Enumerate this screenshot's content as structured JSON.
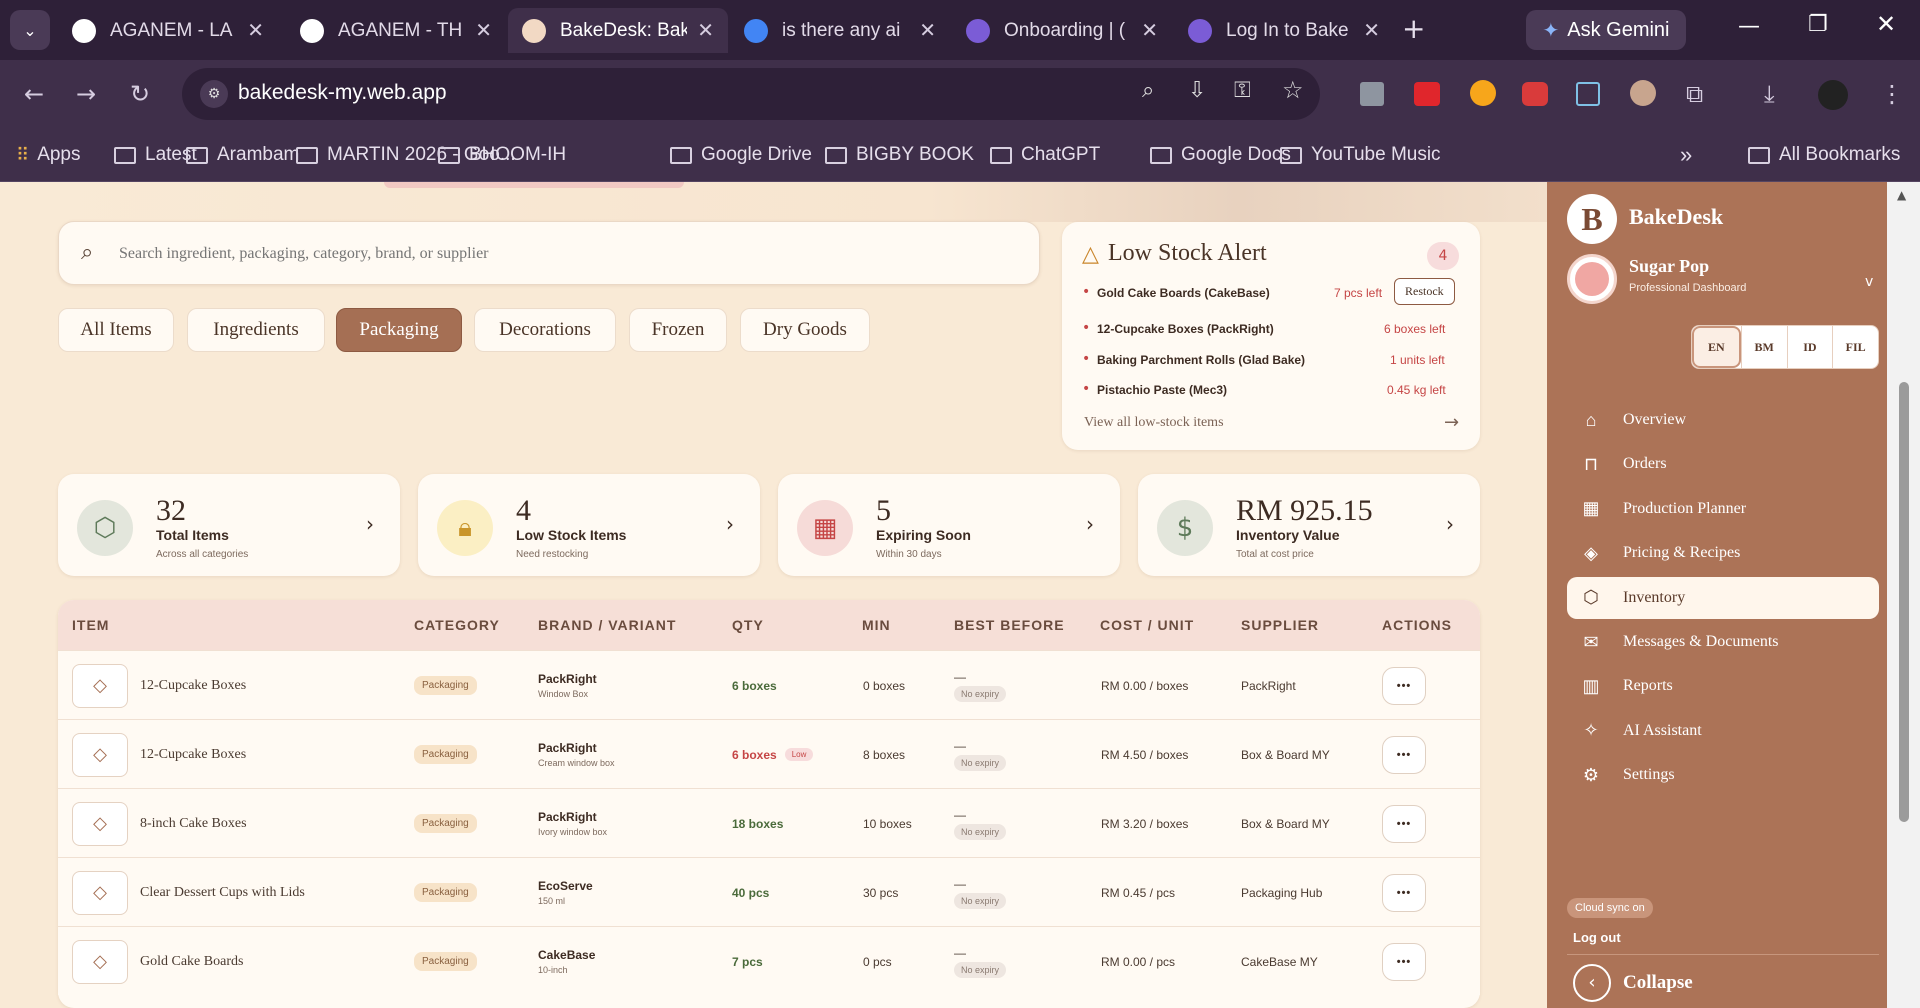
{
  "browser": {
    "tabs": [
      {
        "title": "AGANEM - LA",
        "color": "#ffffff"
      },
      {
        "title": "AGANEM - TH",
        "color": "#ffffff"
      },
      {
        "title": "BakeDesk: Bak",
        "color": "#f2d9c4"
      },
      {
        "title": "is there any ai",
        "color": "#4285f4"
      },
      {
        "title": "Onboarding | (",
        "color": "#7b5cd6"
      },
      {
        "title": "Log In to Bake",
        "color": "#7b5cd6"
      }
    ],
    "ask_gemini": "Ask Gemini",
    "url": "bakedesk-my.web.app",
    "bookmarks": [
      "Apps",
      "Latest",
      "Arambam",
      "MARTIN 2026 - Goo...",
      "BHOOM-IH",
      "Google Drive",
      "BIGBY BOOK",
      "ChatGPT",
      "Google Docs",
      "YouTube Music"
    ],
    "all_bookmarks": "All Bookmarks"
  },
  "search": {
    "placeholder": "Search ingredient, packaging, category, brand, or supplier"
  },
  "filters": [
    "All Items",
    "Ingredients",
    "Packaging",
    "Decorations",
    "Frozen",
    "Dry Goods"
  ],
  "low_stock": {
    "title": "Low Stock Alert",
    "count": "4",
    "items": [
      {
        "name": "Gold Cake Boards (CakeBase)",
        "qty": "7 pcs left",
        "restock": "Restock"
      },
      {
        "name": "12-Cupcake Boxes (PackRight)",
        "qty": "6 boxes left"
      },
      {
        "name": "Baking Parchment Rolls (Glad Bake)",
        "qty": "1 units left"
      },
      {
        "name": "Pistachio Paste (Mec3)",
        "qty": "0.45 kg left"
      }
    ],
    "view_all": "View all low-stock items"
  },
  "stats": [
    {
      "num": "32",
      "label": "Total Items",
      "sub": "Across all categories",
      "color": "#e3e6dc",
      "icon": "box-icon"
    },
    {
      "num": "4",
      "label": "Low Stock Items",
      "sub": "Need restocking",
      "color": "#fbefc4",
      "icon": "lock-icon"
    },
    {
      "num": "5",
      "label": "Expiring Soon",
      "sub": "Within 30 days",
      "color": "#f6dbd8",
      "icon": "calendar-icon"
    },
    {
      "num": "RM 925.15",
      "label": "Inventory Value",
      "sub": "Total at cost price",
      "color": "#e3e6dc",
      "icon": "dollar-icon"
    }
  ],
  "table": {
    "headers": [
      "ITEM",
      "CATEGORY",
      "BRAND / VARIANT",
      "QTY",
      "MIN",
      "BEST BEFORE",
      "COST / UNIT",
      "SUPPLIER",
      "ACTIONS"
    ],
    "rows": [
      {
        "item": "12-Cupcake Boxes",
        "category": "Packaging",
        "brand": "PackRight",
        "variant": "Window Box",
        "qty": "6 boxes",
        "low": "",
        "min": "0 boxes",
        "bb": "—",
        "noexp": "No expiry",
        "cost": "RM 0.00 / boxes",
        "supplier": "PackRight"
      },
      {
        "item": "12-Cupcake Boxes",
        "category": "Packaging",
        "brand": "PackRight",
        "variant": "Cream window box",
        "qty": "6 boxes",
        "low": "Low",
        "min": "8 boxes",
        "bb": "—",
        "noexp": "No expiry",
        "cost": "RM 4.50 / boxes",
        "supplier": "Box & Board MY"
      },
      {
        "item": "8-inch Cake Boxes",
        "category": "Packaging",
        "brand": "PackRight",
        "variant": "Ivory window box",
        "qty": "18 boxes",
        "low": "",
        "min": "10 boxes",
        "bb": "—",
        "noexp": "No expiry",
        "cost": "RM 3.20 / boxes",
        "supplier": "Box & Board MY"
      },
      {
        "item": "Clear Dessert Cups with Lids",
        "category": "Packaging",
        "brand": "EcoServe",
        "variant": "150 ml",
        "qty": "40 pcs",
        "low": "",
        "min": "30 pcs",
        "bb": "—",
        "noexp": "No expiry",
        "cost": "RM 0.45 / pcs",
        "supplier": "Packaging Hub"
      },
      {
        "item": "Gold Cake Boards",
        "category": "Packaging",
        "brand": "CakeBase",
        "variant": "10-inch",
        "qty": "7 pcs",
        "low": "",
        "min": "0 pcs",
        "bb": "—",
        "noexp": "No expiry",
        "cost": "RM 0.00 / pcs",
        "supplier": "CakeBase MY"
      }
    ]
  },
  "sidebar": {
    "logo_letter": "B",
    "app": "BakeDesk",
    "shop": "Sugar Pop",
    "shop_sub": "Professional Dashboard",
    "langs": [
      "EN",
      "BM",
      "ID",
      "FIL"
    ],
    "nav": [
      {
        "label": "Overview",
        "icon": "home-icon"
      },
      {
        "label": "Orders",
        "icon": "bag-icon"
      },
      {
        "label": "Production Planner",
        "icon": "calendar-icon"
      },
      {
        "label": "Pricing & Recipes",
        "icon": "tag-icon"
      },
      {
        "label": "Inventory",
        "icon": "box-icon"
      },
      {
        "label": "Messages & Documents",
        "icon": "mail-icon"
      },
      {
        "label": "Reports",
        "icon": "chart-icon"
      },
      {
        "label": "AI Assistant",
        "icon": "sparkle-icon"
      },
      {
        "label": "Settings",
        "icon": "gear-icon"
      }
    ],
    "cloud": "Cloud sync on",
    "logout": "Log out",
    "collapse": "Collapse"
  }
}
